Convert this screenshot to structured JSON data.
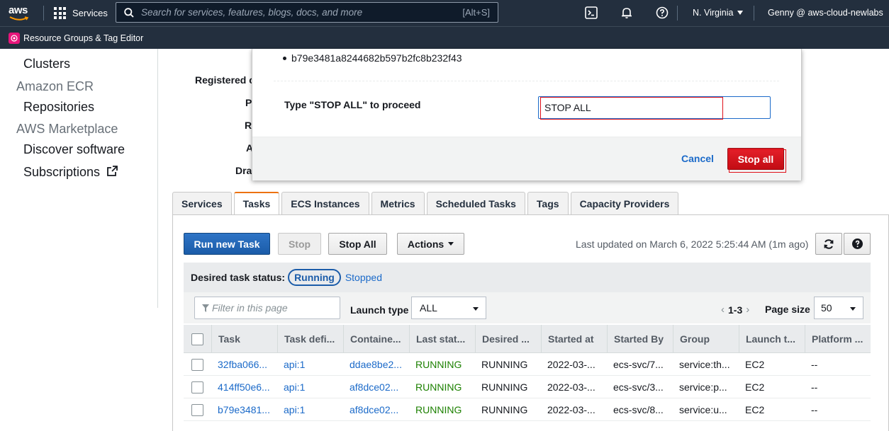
{
  "topnav": {
    "logo_text": "aws",
    "services_label": "Services",
    "search_placeholder": "Search for services, features, blogs, docs, and more",
    "search_shortcut": "[Alt+S]",
    "region": "N. Virginia",
    "account": "Genny @ aws-cloud-newlabs"
  },
  "subnav": {
    "resource_groups_label": "Resource Groups & Tag Editor"
  },
  "sidebar": {
    "items": [
      {
        "label": "Clusters",
        "type": "item"
      },
      {
        "label": "Amazon ECR",
        "type": "group"
      },
      {
        "label": "Repositories",
        "type": "item"
      },
      {
        "label": "AWS Marketplace",
        "type": "group"
      },
      {
        "label": "Discover software",
        "type": "item"
      },
      {
        "label": "Subscriptions",
        "type": "item"
      }
    ]
  },
  "details": {
    "labels": [
      "Registered c",
      "P",
      "R",
      "A",
      "Dra"
    ]
  },
  "tabs": [
    {
      "label": "Services",
      "active": false
    },
    {
      "label": "Tasks",
      "active": true
    },
    {
      "label": "ECS Instances",
      "active": false
    },
    {
      "label": "Metrics",
      "active": false
    },
    {
      "label": "Scheduled Tasks",
      "active": false
    },
    {
      "label": "Tags",
      "active": false
    },
    {
      "label": "Capacity Providers",
      "active": false
    }
  ],
  "toolbar": {
    "run_new_task": "Run new Task",
    "stop": "Stop",
    "stop_all": "Stop All",
    "actions": "Actions",
    "last_updated": "Last updated on March 6, 2022 5:25:44 AM (1m ago)"
  },
  "status_filter": {
    "label": "Desired task status:",
    "running": "Running",
    "stopped": "Stopped"
  },
  "filters": {
    "filter_placeholder": "Filter in this page",
    "launch_type_label": "Launch type",
    "launch_type_value": "ALL",
    "pager_range": "1-3",
    "page_size_label": "Page size",
    "page_size_value": "50"
  },
  "table": {
    "columns": [
      "Task",
      "Task defi...",
      "Containe...",
      "Last stat...",
      "Desired ...",
      "Started at",
      "Started By",
      "Group",
      "Launch t...",
      "Platform ..."
    ],
    "rows": [
      [
        "32fba066...",
        "api:1",
        "ddae8be2...",
        "RUNNING",
        "RUNNING",
        "2022-03-...",
        "ecs-svc/7...",
        "service:th...",
        "EC2",
        "--"
      ],
      [
        "414ff50e6...",
        "api:1",
        "af8dce02...",
        "RUNNING",
        "RUNNING",
        "2022-03-...",
        "ecs-svc/3...",
        "service:p...",
        "EC2",
        "--"
      ],
      [
        "b79e3481...",
        "api:1",
        "af8dce02...",
        "RUNNING",
        "RUNNING",
        "2022-03-...",
        "ecs-svc/8...",
        "service:u...",
        "EC2",
        "--"
      ]
    ]
  },
  "modal": {
    "task_id": "b79e3481a8244682b597b2fc8b232f43",
    "confirm_label": "Type \"STOP ALL\" to proceed",
    "confirm_value": "STOP ALL",
    "cancel_label": "Cancel",
    "stop_all_label": "Stop all"
  },
  "colors": {
    "nav_bg": "#232f3e",
    "primary": "#1b5ca9",
    "danger": "#d0111a",
    "running": "#1d8102",
    "tab_accent": "#ec7211"
  }
}
